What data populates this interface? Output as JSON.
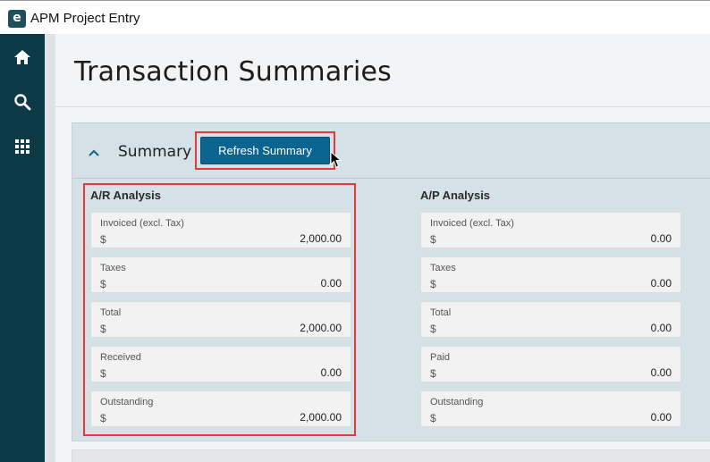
{
  "window": {
    "app_title": "APM Project Entry",
    "logo_letter": "e"
  },
  "sidebar": {
    "items": [
      {
        "icon": "home-icon"
      },
      {
        "icon": "search-icon"
      },
      {
        "icon": "apps-grid-icon"
      }
    ]
  },
  "page": {
    "title": "Transaction Summaries"
  },
  "summary": {
    "header_label": "Summary",
    "refresh_button_label": "Refresh Summary",
    "ar": {
      "title": "A/R Analysis",
      "fields": [
        {
          "label": "Invoiced (excl. Tax)",
          "currency": "$",
          "value": "2,000.00"
        },
        {
          "label": "Taxes",
          "currency": "$",
          "value": "0.00"
        },
        {
          "label": "Total",
          "currency": "$",
          "value": "2,000.00"
        },
        {
          "label": "Received",
          "currency": "$",
          "value": "0.00"
        },
        {
          "label": "Outstanding",
          "currency": "$",
          "value": "2,000.00"
        }
      ]
    },
    "ap": {
      "title": "A/P Analysis",
      "fields": [
        {
          "label": "Invoiced (excl. Tax)",
          "currency": "$",
          "value": "0.00"
        },
        {
          "label": "Taxes",
          "currency": "$",
          "value": "0.00"
        },
        {
          "label": "Total",
          "currency": "$",
          "value": "0.00"
        },
        {
          "label": "Paid",
          "currency": "$",
          "value": "0.00"
        },
        {
          "label": "Outstanding",
          "currency": "$",
          "value": "0.00"
        }
      ]
    }
  },
  "colors": {
    "sidebar": "#0d3a47",
    "accent_button": "#0c6590",
    "highlight": "#e33a3f",
    "card": "#d4e1e6"
  }
}
